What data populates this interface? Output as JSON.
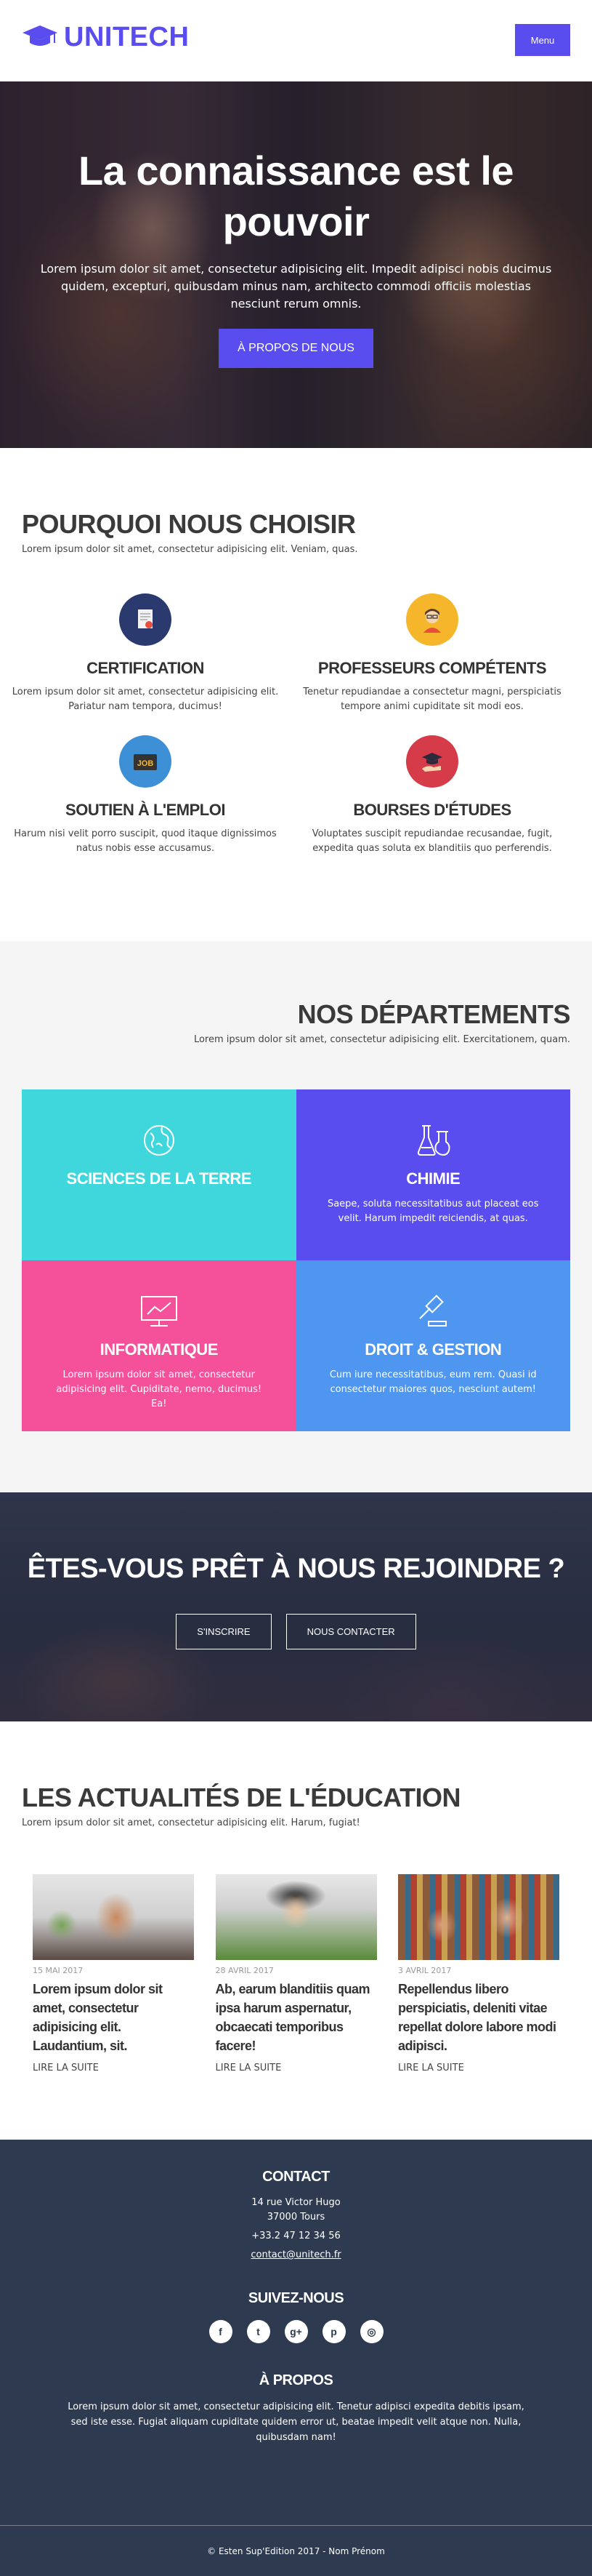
{
  "header": {
    "logo_text": "UNITECH",
    "menu_label": "Menu"
  },
  "hero": {
    "title": "La connaissance est le pouvoir",
    "text": "Lorem ipsum dolor sit amet, consectetur adipisicing elit. Impedit adipisci nobis ducimus quidem, excepturi, quibusdam minus nam, architecto commodi officiis molestias nesciunt rerum omnis.",
    "button": "À PROPOS DE NOUS"
  },
  "why": {
    "title": "POURQUOI NOUS CHOISIR",
    "subtitle": "Lorem ipsum dolor sit amet, consectetur adipisicing elit. Veniam, quas.",
    "features": [
      {
        "title": "CERTIFICATION",
        "text": "Lorem ipsum dolor sit amet, consectetur adipisicing elit. Pariatur nam tempora, ducimus!",
        "icon": "certificate-icon",
        "color": "#2a3a6e"
      },
      {
        "title": "PROFESSEURS COMPÉTENTS",
        "text": "Tenetur repudiandae a consectetur magni, perspiciatis tempore animi cupiditate sit modi eos.",
        "icon": "teacher-icon",
        "color": "#f6b62c"
      },
      {
        "title": "SOUTIEN À L'EMPLOI",
        "text": "Harum nisi velit porro suscipit, quod itaque dignissimos natus nobis esse accusamus.",
        "icon": "job-icon",
        "color": "#3d8fd6"
      },
      {
        "title": "BOURSES D'ÉTUDES",
        "text": "Voluptates suscipit repudiandae recusandae, fugit, expedita quas soluta ex blanditiis quo perferendis.",
        "icon": "scholarship-icon",
        "color": "#d63b4a"
      }
    ]
  },
  "departments": {
    "title": "NOS DÉPARTEMENTS",
    "subtitle": "Lorem ipsum dolor sit amet, consectetur adipisicing elit. Exercitationem, quam.",
    "items": [
      {
        "name": "SCIENCES DE LA TERRE",
        "text": "",
        "color": "#3fd6dc",
        "icon": "earth-icon"
      },
      {
        "name": "CHIMIE",
        "text": "Saepe, soluta necessitatibus aut placeat eos velit. Harum impedit reiciendis, at quas.",
        "color": "#5a4df0",
        "icon": "flask-icon"
      },
      {
        "name": "INFORMATIQUE",
        "text": "Lorem ipsum dolor sit amet, consectetur adipisicing elit. Cupiditate, nemo, ducimus! Ea!",
        "color": "#f5509a",
        "icon": "computer-icon"
      },
      {
        "name": "DROIT & GESTION",
        "text": "Cum iure necessitatibus, eum rem. Quasi id consectetur maiores quos, nesciunt autem!",
        "color": "#4f96f0",
        "icon": "gavel-icon"
      }
    ]
  },
  "cta": {
    "title": "ÊTES-VOUS PRÊT À NOUS REJOINDRE ?",
    "signup": "S'INSCRIRE",
    "contact": "NOUS CONTACTER"
  },
  "news": {
    "title": "LES ACTUALITÉS DE L'ÉDUCATION",
    "subtitle": "Lorem ipsum dolor sit amet, consectetur adipisicing elit. Harum, fugiat!",
    "articles": [
      {
        "date": "15 MAI 2017",
        "title": "Lorem ipsum dolor sit amet, consectetur adipisicing elit. Laudantium, sit.",
        "link": "LIRE LA SUITE"
      },
      {
        "date": "28 AVRIL 2017",
        "title": "Ab, earum blanditiis quam ipsa harum aspernatur, obcaecati temporibus facere!",
        "link": "LIRE LA SUITE"
      },
      {
        "date": "3 AVRIL 2017",
        "title": "Repellendus libero perspiciatis, deleniti vitae repellat dolore labore modi adipisci.",
        "link": "LIRE LA SUITE"
      }
    ]
  },
  "footer": {
    "contact_title": "CONTACT",
    "address1": "14 rue Victor Hugo",
    "address2": "37000 Tours",
    "phone": "+33.2 47 12 34 56",
    "email": "contact@unitech.fr",
    "follow_title": "SUIVEZ-NOUS",
    "social": [
      {
        "icon": "facebook-icon",
        "glyph": "f"
      },
      {
        "icon": "twitter-icon",
        "glyph": "t"
      },
      {
        "icon": "google-plus-icon",
        "glyph": "g+"
      },
      {
        "icon": "pinterest-icon",
        "glyph": "p"
      },
      {
        "icon": "instagram-icon",
        "glyph": "◎"
      }
    ],
    "about_title": "À PROPOS",
    "about_text": "Lorem ipsum dolor sit amet, consectetur adipisicing elit. Tenetur adipisci expedita debitis ipsam, sed iste esse. Fugiat aliquam cupiditate quidem error ut, beatae impedit velit atque non. Nulla, quibusdam nam!",
    "copyright": "© Esten Sup'Edition 2017 - Nom Prénom"
  }
}
